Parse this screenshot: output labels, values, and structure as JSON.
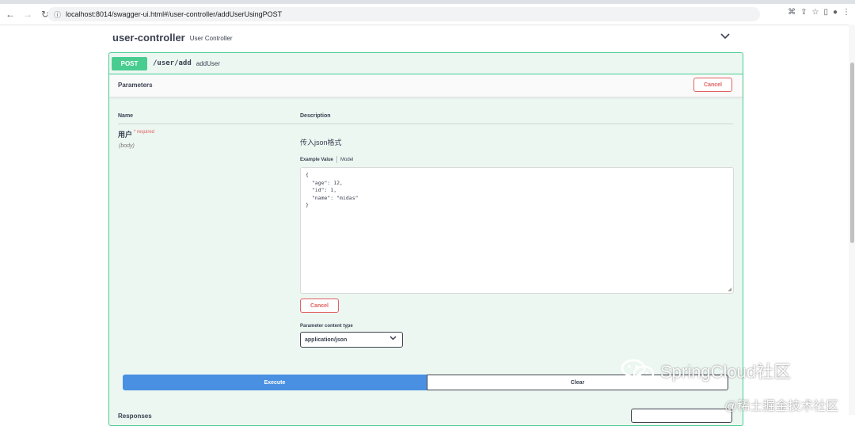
{
  "browser": {
    "url": "localhost:8014/swagger-ui.html#/user-controller/addUserUsingPOST"
  },
  "controller": {
    "name": "user-controller",
    "description": "User Controller"
  },
  "operation": {
    "method": "POST",
    "path": "/user/add",
    "summary": "addUser",
    "parameters_title": "Parameters",
    "cancel_top_label": "Cancel",
    "col_name": "Name",
    "col_description": "Description",
    "param": {
      "name": "用户",
      "required": "* required",
      "in": "(body)",
      "description": "传入json格式"
    },
    "tabs": {
      "example": "Example Value",
      "model": "Model"
    },
    "example_json": "{\n  \"age\": 12,\n  \"id\": 1,\n  \"name\": \"midas\"\n}",
    "cancel_label": "Cancel",
    "content_type_label": "Parameter content type",
    "content_type_value": "application/json",
    "execute_label": "Execute",
    "clear_label": "Clear",
    "responses_label": "Responses"
  },
  "watermarks": {
    "primary": "SpringCloud社区",
    "secondary": "@稀土掘金技术社区"
  },
  "colors": {
    "post_accent": "#49cc90",
    "execute_blue": "#4990e2",
    "cancel_red": "#e06060"
  }
}
